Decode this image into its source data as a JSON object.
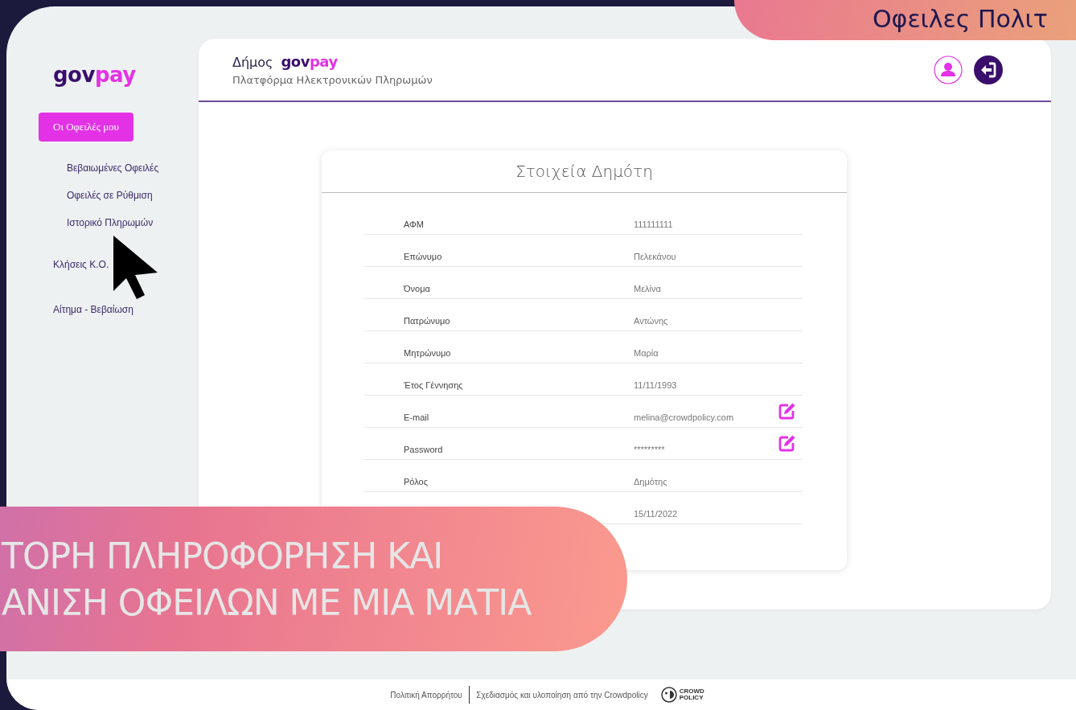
{
  "top_banner": {
    "text": "Οφειλες Πολιτ"
  },
  "sidebar": {
    "logo": {
      "first": "gov",
      "second": "pay"
    },
    "items": [
      {
        "label": "Οι Οφειλές μου",
        "selected": true,
        "children": [
          {
            "label": "Βεβαιωμένες Οφειλές",
            "selected": false
          },
          {
            "label": "Οφειλές σε Ρύθμιση",
            "selected": false
          },
          {
            "label": "Ιστορικό Πληρωμών",
            "selected": false
          }
        ]
      },
      {
        "label": "Κλήσεις Κ.Ο.",
        "selected": false
      },
      {
        "label": "Αίτημα - Βεβαίωση",
        "selected": false
      }
    ]
  },
  "header": {
    "prefix": "Δήμος",
    "logo": {
      "first": "gov",
      "second": "pay"
    },
    "subtitle": "Πλατφόρμα Ηλεκτρονικών Πληρωμών"
  },
  "profile_card": {
    "title": "Στοιχεία Δημότη",
    "rows": [
      {
        "label": "ΑΦΜ",
        "value": "111111111",
        "editable": false
      },
      {
        "label": "Επώνυμο",
        "value": "Πελεκάνου",
        "editable": false
      },
      {
        "label": "Όνομα",
        "value": "Μελίνα",
        "editable": false
      },
      {
        "label": "Πατρώνυμο",
        "value": "Αντώνης",
        "editable": false
      },
      {
        "label": "Μητρώνυμο",
        "value": "Μαρία",
        "editable": false
      },
      {
        "label": "Έτος Γέννησης",
        "value": "11/11/1993",
        "editable": false
      },
      {
        "label": "E-mail",
        "value": "melina@crowdpolicy.com",
        "editable": true
      },
      {
        "label": "Password",
        "value": "*********",
        "editable": true
      },
      {
        "label": "Ρόλος",
        "value": "Δημότης",
        "editable": false
      },
      {
        "value": "15/11/2022",
        "editable": false
      }
    ]
  },
  "bottom_banner": {
    "lines": [
      "ΤΟΡΗ ΠΛΗΡΟΦΟΡΗΣΗ ΚΑΙ",
      "ΑΝΙΣΗ ΟΦΕΙΛΩΝ ΜΕ ΜΙΑ ΜΑΤΙΑ"
    ]
  },
  "footer": {
    "privacy_link": "Πολιτική Απορρήτου",
    "credit": "Σχεδιασμός και υλοποίηση από την Crowdpolicy",
    "logo_text": "CROWD POLICY"
  }
}
